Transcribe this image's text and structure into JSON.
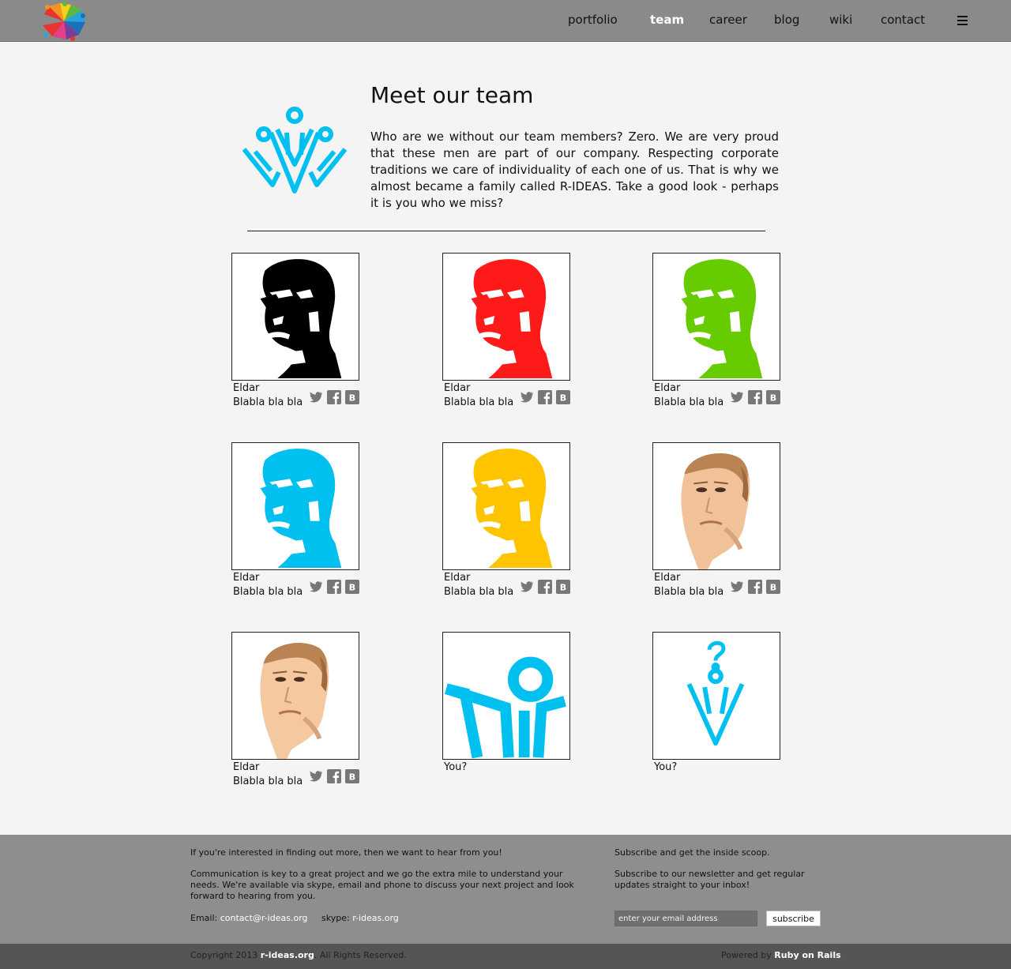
{
  "header": {
    "nav": [
      "portfolio",
      "team",
      "career",
      "blog",
      "wiki",
      "contact"
    ],
    "active": "team",
    "menu_icon": "hamburger-icon"
  },
  "intro": {
    "title": "Meet our team",
    "text": "Who are we without our team members? Zero. We are very proud that these men are part of our company. Respecting corporate traditions we care of individuality of each one of us. That is why we almost became a family called R-IDEAS. Take a good look - perhaps it is you who we miss?"
  },
  "team": [
    {
      "name": "Eldar",
      "desc": "Blabla bla bla",
      "photo": "silhouette",
      "color": "#000000"
    },
    {
      "name": "Eldar",
      "desc": "Blabla bla bla",
      "photo": "silhouette",
      "color": "#ff1a1a"
    },
    {
      "name": "Eldar",
      "desc": "Blabla bla bla",
      "photo": "silhouette",
      "color": "#66cc00"
    },
    {
      "name": "Eldar",
      "desc": "Blabla bla bla",
      "photo": "silhouette",
      "color": "#00c0f0"
    },
    {
      "name": "Eldar",
      "desc": "Blabla bla bla",
      "photo": "silhouette",
      "color": "#ffc400"
    },
    {
      "name": "Eldar",
      "desc": "Blabla bla bla",
      "photo": "portrait",
      "color": "#f1c29a"
    },
    {
      "name": "Eldar",
      "desc": "Blabla bla bla",
      "photo": "portrait",
      "color": "#f5c9a0"
    }
  ],
  "vacancies": [
    {
      "name": "You?",
      "icon": "person-arms-icon"
    },
    {
      "name": "You?",
      "icon": "question-person-icon"
    }
  ],
  "socials": [
    "twitter-icon",
    "facebook-icon",
    "vk-icon"
  ],
  "footer": {
    "interest": "If you're interested in finding out more, then we want to hear from you!",
    "communication": "Communication is key to a great project and we go the extra mile to understand your needs. We're available via skype, email and phone to discuss your next project and look forward to hearing from you.",
    "email_label": "Email:",
    "email": "contact@r-ideas.org",
    "skype_label": "skype:",
    "skype": "r-ideas.org",
    "subscribe_title": "Subscribe and get the inside scoop.",
    "subscribe_text": "Subscribe to our newsletter and get regular updates straight to your inbox!",
    "email_placeholder": "enter your email address",
    "subscribe_button": "subscribe",
    "copyright_prefix": "Copyright 2013",
    "copyright_site": "r-ideas.org",
    "copyright_suffix": ". All Rights Reserved.",
    "powered_prefix": "Powered by",
    "powered_by": "Ruby on Rails"
  },
  "accent": "#00c0f0"
}
